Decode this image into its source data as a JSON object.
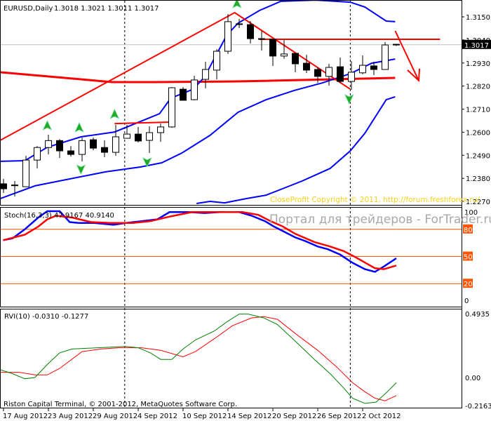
{
  "chart_data": {
    "type": "candlestick",
    "symbol_title": "EURUSD,Daily",
    "ohlc_readout": "1.3018 1.3021 1.3011 1.3017",
    "current_price": "1.3017",
    "y_ticks": [
      "1.3150",
      "1.3040",
      "1.2930",
      "1.2820",
      "1.2710",
      "1.2600",
      "1.2490",
      "1.2380",
      "1.2270"
    ],
    "x_ticks": [
      {
        "index": 0,
        "label": "17 Aug 2012"
      },
      {
        "index": 4,
        "label": "23 Aug 2012"
      },
      {
        "index": 8,
        "label": "29 Aug 2012"
      },
      {
        "index": 12,
        "label": "4 Sep 2012"
      },
      {
        "index": 16,
        "label": "10 Sep 2012"
      },
      {
        "index": 20,
        "label": "14 Sep 2012"
      },
      {
        "index": 24,
        "label": "20 Sep 2012"
      },
      {
        "index": 28,
        "label": "26 Sep 2012"
      },
      {
        "index": 32,
        "label": "2 Oct 2012"
      }
    ],
    "period_separators": [
      10.8,
      30.9
    ],
    "candles": [
      [
        1.2354,
        1.2377,
        1.231,
        1.233
      ],
      [
        1.2347,
        1.2367,
        1.2293,
        1.2346
      ],
      [
        1.234,
        1.2487,
        1.234,
        1.2467
      ],
      [
        1.2467,
        1.2534,
        1.2427,
        1.2527
      ],
      [
        1.2527,
        1.2588,
        1.2494,
        1.256
      ],
      [
        1.256,
        1.2567,
        1.2477,
        1.2511
      ],
      [
        1.2511,
        1.2534,
        1.2484,
        1.2494
      ],
      [
        1.2494,
        1.2574,
        1.2461,
        1.256
      ],
      [
        1.2564,
        1.2574,
        1.2514,
        1.2524
      ],
      [
        1.2527,
        1.2561,
        1.2481,
        1.2504
      ],
      [
        1.2504,
        1.2635,
        1.2487,
        1.2578
      ],
      [
        1.2571,
        1.2635,
        1.2571,
        1.2591
      ],
      [
        1.2591,
        1.2625,
        1.2551,
        1.2558
      ],
      [
        1.2561,
        1.2628,
        1.2501,
        1.2598
      ],
      [
        1.2598,
        1.2641,
        1.2554,
        1.2625
      ],
      [
        1.2625,
        1.2815,
        1.2621,
        1.2812
      ],
      [
        1.2805,
        1.2815,
        1.2752,
        1.2752
      ],
      [
        1.2755,
        1.2869,
        1.2752,
        1.2849
      ],
      [
        1.2852,
        1.2936,
        1.2809,
        1.2899
      ],
      [
        1.2896,
        1.2996,
        1.2852,
        1.2986
      ],
      [
        1.2986,
        1.3163,
        1.2973,
        1.3127
      ],
      [
        1.3117,
        1.314,
        1.3096,
        1.3113
      ],
      [
        1.3113,
        1.313,
        1.3023,
        1.3046
      ],
      [
        1.3046,
        1.3083,
        1.2989,
        1.3043
      ],
      [
        1.3043,
        1.3043,
        1.2916,
        1.2963
      ],
      [
        1.2963,
        1.304,
        1.295,
        1.2973
      ],
      [
        1.2976,
        1.2976,
        1.2886,
        1.2926
      ],
      [
        1.2929,
        1.2969,
        1.2882,
        1.2896
      ],
      [
        1.2899,
        1.2909,
        1.2835,
        1.2866
      ],
      [
        1.2866,
        1.2926,
        1.2822,
        1.2909
      ],
      [
        1.2912,
        1.2956,
        1.2835,
        1.2842
      ],
      [
        1.2842,
        1.2939,
        1.2802,
        1.2886
      ],
      [
        1.2883,
        1.2966,
        1.2876,
        1.2919
      ],
      [
        1.2916,
        1.2936,
        1.2872,
        1.2899
      ],
      [
        1.2899,
        1.303,
        1.2899,
        1.3016
      ],
      [
        1.3018,
        1.3021,
        1.3011,
        1.3017
      ]
    ],
    "bands": {
      "color": "#0000ff",
      "upper": [
        [
          -0.3,
          1.2461
        ],
        [
          1.9,
          1.2464
        ],
        [
          3.9,
          1.2528
        ],
        [
          6.9,
          1.2578
        ],
        [
          9.9,
          1.2601
        ],
        [
          13.9,
          1.2688
        ],
        [
          14.9,
          1.2762
        ],
        [
          16.9,
          1.2805
        ],
        [
          17.9,
          1.2862
        ],
        [
          18.9,
          1.2963
        ],
        [
          19.9,
          1.3063
        ],
        [
          20.9,
          1.312
        ],
        [
          22.8,
          1.318
        ],
        [
          24.7,
          1.3224
        ],
        [
          27.8,
          1.323
        ],
        [
          30.9,
          1.322
        ],
        [
          32.2,
          1.3197
        ],
        [
          34.1,
          1.313
        ],
        [
          34.9,
          1.3127
        ]
      ],
      "middle": [
        [
          -0.3,
          1.2283
        ],
        [
          2.8,
          1.2344
        ],
        [
          5.9,
          1.2377
        ],
        [
          9.1,
          1.2411
        ],
        [
          12.2,
          1.2434
        ],
        [
          14.1,
          1.2454
        ],
        [
          15.9,
          1.2501
        ],
        [
          18.4,
          1.2585
        ],
        [
          20.9,
          1.2695
        ],
        [
          23.4,
          1.2755
        ],
        [
          25.9,
          1.2799
        ],
        [
          28.4,
          1.2835
        ],
        [
          30.9,
          1.2879
        ],
        [
          32.8,
          1.2929
        ],
        [
          34.9,
          1.2949
        ]
      ],
      "lower": [
        [
          17.2,
          1.226
        ],
        [
          18.4,
          1.227
        ],
        [
          19.7,
          1.2263
        ],
        [
          21.6,
          1.2283
        ],
        [
          23.4,
          1.23
        ],
        [
          24.7,
          1.2327
        ],
        [
          26.6,
          1.2367
        ],
        [
          29.1,
          1.2427
        ],
        [
          30.9,
          1.2511
        ],
        [
          32.2,
          1.2595
        ],
        [
          34.1,
          1.2755
        ],
        [
          34.9,
          1.2769
        ]
      ]
    },
    "red_lines": {
      "color": "#ff0000",
      "trend_channel": [
        [
          -0.3,
          1.2561
        ],
        [
          20.6,
          1.317
        ],
        [
          30.9,
          1.2805
        ]
      ],
      "moving_average": [
        [
          -0.3,
          1.2886
        ],
        [
          9.7,
          1.2839
        ],
        [
          13.5,
          1.2839
        ],
        [
          20.3,
          1.2842
        ],
        [
          21.6,
          1.2843
        ],
        [
          34.9,
          1.2859
        ]
      ],
      "resistance": [
        [
          22.8,
          1.3043
        ],
        [
          38.9,
          1.3043
        ]
      ],
      "short_level": [
        [
          9.9,
          1.2641
        ],
        [
          14.9,
          1.2648
        ]
      ],
      "forecast_arrow": [
        [
          34.9,
          1.3083
        ],
        [
          37.0,
          1.2846
        ]
      ]
    },
    "fractals": {
      "color": "#22aa22",
      "up": [
        [
          3.9,
          1.2628
        ],
        [
          6.75,
          1.2618
        ],
        [
          9.9,
          1.2682
        ],
        [
          20.8,
          1.321
        ]
      ],
      "down": [
        [
          6.9,
          1.2427
        ],
        [
          12.8,
          1.2461
        ],
        [
          30.8,
          1.2762
        ]
      ]
    },
    "stochastic": {
      "label": "Stoch(16,3,3) 47.9167 40.9140",
      "axis_ticks": [
        "100",
        "0"
      ],
      "levels": [
        "80",
        "50",
        "20"
      ],
      "level_color": "#ff5500",
      "k_color": "#0000ff",
      "d_color": "#ff0000",
      "k": [
        [
          -0.03,
          68
        ],
        [
          0.8,
          70
        ],
        [
          1.9,
          80
        ],
        [
          3.1,
          93
        ],
        [
          3.9,
          100
        ],
        [
          5.0,
          100
        ],
        [
          5.9,
          88
        ],
        [
          6.7,
          87
        ],
        [
          8.1,
          87
        ],
        [
          9.8,
          85
        ],
        [
          10.9,
          87
        ],
        [
          12.3,
          89
        ],
        [
          13.7,
          91
        ],
        [
          14.8,
          99
        ],
        [
          16.5,
          99
        ],
        [
          17.9,
          98
        ],
        [
          19.3,
          99
        ],
        [
          21.0,
          99
        ],
        [
          22.1,
          95
        ],
        [
          23.3,
          89
        ],
        [
          24.1,
          83
        ],
        [
          24.9,
          78
        ],
        [
          26.0,
          71
        ],
        [
          26.9,
          67
        ],
        [
          28.0,
          61
        ],
        [
          28.9,
          58
        ],
        [
          30.0,
          52
        ],
        [
          31.1,
          43
        ],
        [
          32.2,
          36
        ],
        [
          33.1,
          33
        ],
        [
          33.9,
          39
        ],
        [
          35.0,
          48
        ]
      ],
      "d": [
        [
          -0.03,
          68
        ],
        [
          1.9,
          74
        ],
        [
          3.1,
          83
        ],
        [
          3.9,
          91
        ],
        [
          4.7,
          95
        ],
        [
          6.1,
          93
        ],
        [
          7.8,
          88
        ],
        [
          9.5,
          87
        ],
        [
          11.5,
          87
        ],
        [
          13.1,
          89
        ],
        [
          14.8,
          94
        ],
        [
          16.8,
          99
        ],
        [
          18.8,
          99
        ],
        [
          21.3,
          99
        ],
        [
          22.7,
          96
        ],
        [
          23.8,
          89
        ],
        [
          24.9,
          83
        ],
        [
          26.0,
          75
        ],
        [
          27.7,
          66
        ],
        [
          29.1,
          61
        ],
        [
          30.3,
          56
        ],
        [
          31.4,
          49
        ],
        [
          33.1,
          37
        ],
        [
          33.9,
          36
        ],
        [
          35.0,
          40
        ]
      ]
    },
    "rvi": {
      "label": "RVI(10) -0.0310 -0.1277",
      "axis_ticks": [
        "0.4935",
        "0.00",
        "-0.2163"
      ],
      "main_color": "#008000",
      "signal_color": "#ff0000",
      "main": [
        [
          -0.3,
          0.06
        ],
        [
          0.8,
          0.03
        ],
        [
          1.9,
          -0.01
        ],
        [
          2.8,
          0.0
        ],
        [
          3.9,
          0.1
        ],
        [
          5.0,
          0.19
        ],
        [
          6.1,
          0.22
        ],
        [
          8.4,
          0.23
        ],
        [
          10.9,
          0.24
        ],
        [
          12.0,
          0.23
        ],
        [
          13.1,
          0.19
        ],
        [
          14.0,
          0.14
        ],
        [
          15.0,
          0.14
        ],
        [
          16.0,
          0.22
        ],
        [
          17.1,
          0.29
        ],
        [
          18.8,
          0.36
        ],
        [
          19.9,
          0.43
        ],
        [
          21.0,
          0.49
        ],
        [
          21.8,
          0.49
        ],
        [
          23.2,
          0.46
        ],
        [
          24.4,
          0.41
        ],
        [
          26.0,
          0.28
        ],
        [
          27.7,
          0.14
        ],
        [
          29.1,
          0.03
        ],
        [
          30.3,
          -0.08
        ],
        [
          31.1,
          -0.16
        ],
        [
          32.2,
          -0.2
        ],
        [
          33.2,
          -0.19
        ],
        [
          34.2,
          -0.11
        ],
        [
          35.0,
          -0.04
        ]
      ],
      "signal": [
        [
          -0.3,
          0.04
        ],
        [
          1.4,
          0.04
        ],
        [
          2.8,
          0.02
        ],
        [
          3.9,
          0.02
        ],
        [
          5.0,
          0.07
        ],
        [
          7.0,
          0.2
        ],
        [
          8.7,
          0.22
        ],
        [
          10.3,
          0.23
        ],
        [
          12.3,
          0.23
        ],
        [
          14.0,
          0.21
        ],
        [
          16.0,
          0.16
        ],
        [
          17.1,
          0.2
        ],
        [
          18.8,
          0.3
        ],
        [
          20.4,
          0.4
        ],
        [
          22.1,
          0.46
        ],
        [
          23.2,
          0.47
        ],
        [
          24.4,
          0.45
        ],
        [
          26.0,
          0.34
        ],
        [
          28.0,
          0.21
        ],
        [
          29.7,
          0.08
        ],
        [
          31.1,
          -0.04
        ],
        [
          32.2,
          -0.11
        ],
        [
          33.1,
          -0.16
        ],
        [
          34.0,
          -0.18
        ],
        [
          35.0,
          -0.14
        ]
      ]
    }
  },
  "watermarks": {
    "indicator_copyright": "CloseProfit Copyright © 2011, http://forum.freshforex.ru/",
    "portal": "Портал для трейдеров - ForTrader.ru",
    "terminal": "Riston Capital Terminal, © 2001-2012, MetaQuotes Software Corp."
  }
}
